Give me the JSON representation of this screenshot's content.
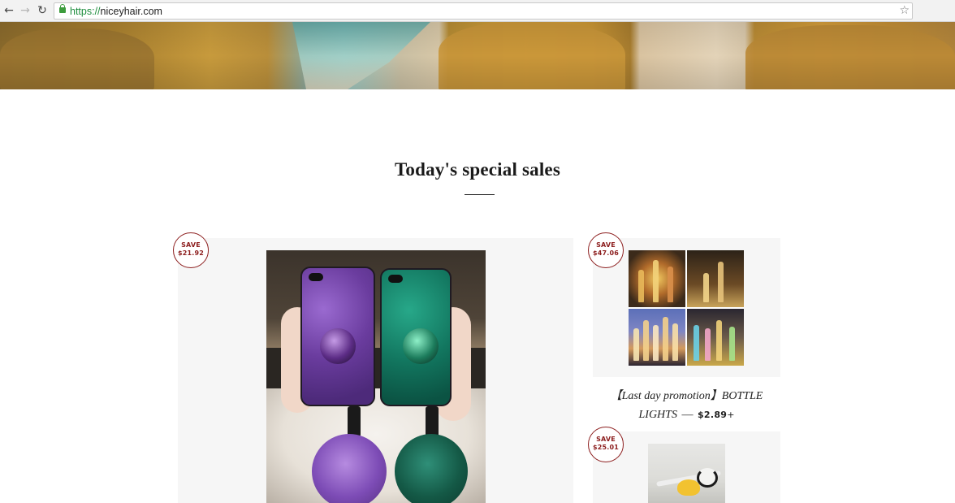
{
  "browser": {
    "url_scheme": "https://",
    "url_host": "niceyhair.com",
    "back_icon": "back-arrow-icon",
    "forward_icon": "forward-arrow-icon",
    "reload_icon": "reload-icon",
    "secure_icon": "lock-icon",
    "bookmark_icon": "star-icon"
  },
  "hero": {
    "image": "beach-cliffs-banner"
  },
  "section": {
    "title": "Today's special sales"
  },
  "products": [
    {
      "save_label": "SAVE",
      "save_amount": "$21.92",
      "image": "purple-and-green-glitter-phone-cases-with-pom-poms"
    },
    {
      "save_label": "SAVE",
      "save_amount": "$47.06",
      "image": "bottle-lights-collage",
      "title": "【Last day promotion】BOTTLE LIGHTS",
      "separator": "—",
      "price": "$2.89",
      "price_suffix": "+"
    },
    {
      "save_label": "SAVE",
      "save_amount": "$25.01",
      "image": "cable-protector-toy"
    }
  ],
  "colors": {
    "badge": "#8c1d1d",
    "card_bg": "#f6f6f6",
    "title_text": "#1a1a1a",
    "url_scheme": "#1e8e3e"
  }
}
